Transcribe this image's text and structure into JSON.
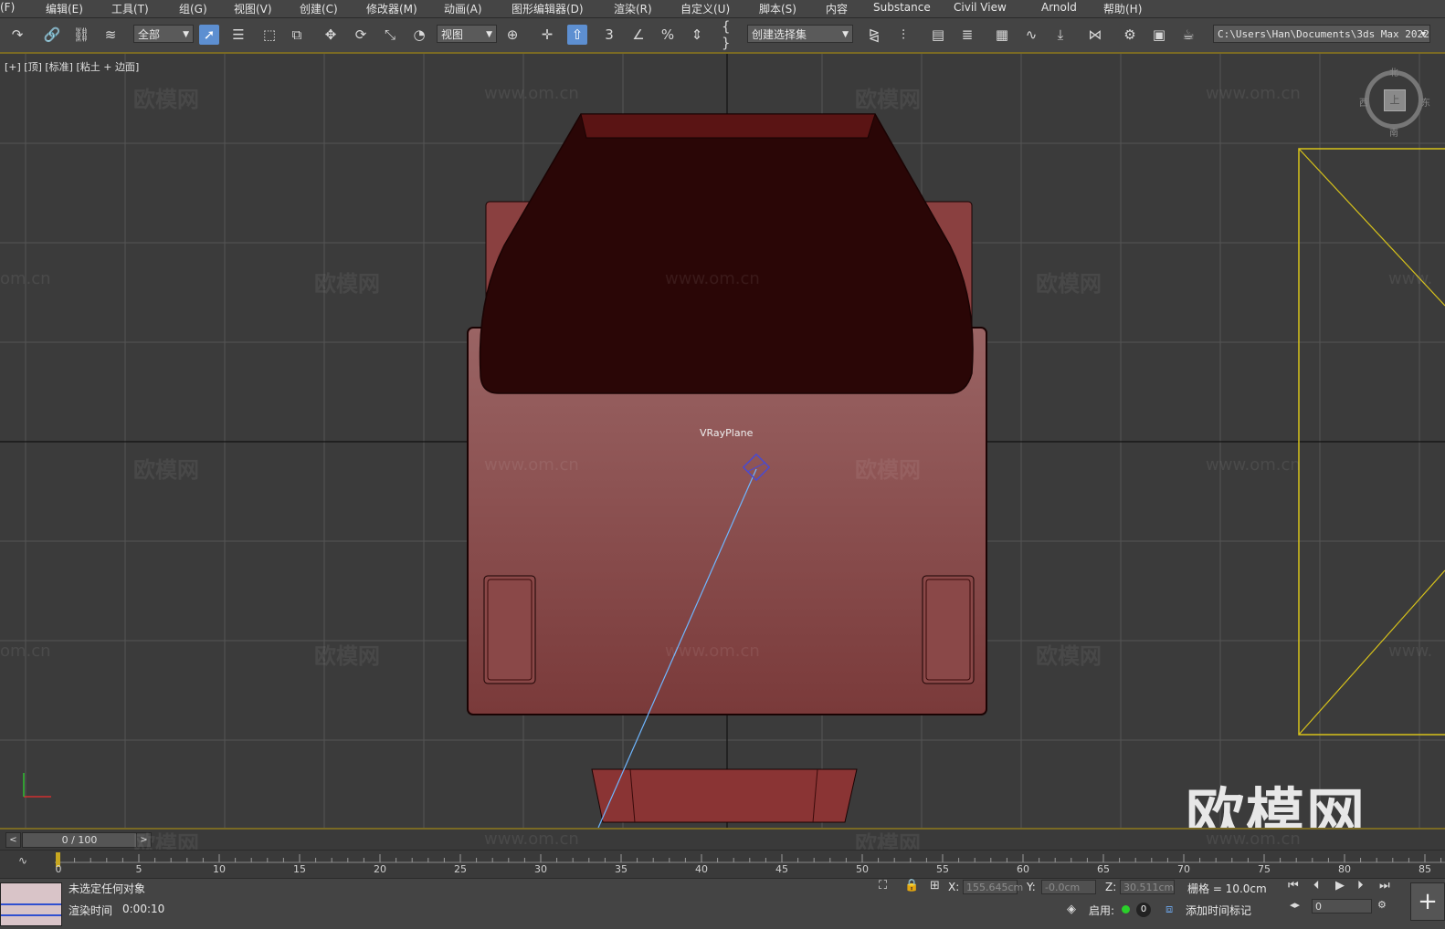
{
  "menu": [
    "(F)",
    "编辑(E)",
    "工具(T)",
    "组(G)",
    "视图(V)",
    "创建(C)",
    "修改器(M)",
    "动画(A)",
    "图形编辑器(D)",
    "渲染(R)",
    "自定义(U)",
    "脚本(S)",
    "内容",
    "Substance",
    "Civil View",
    "Arnold",
    "帮助(H)"
  ],
  "toolbar": {
    "selection_filter": "全部",
    "ref_coord": "视图",
    "named_selection": "创建选择集",
    "project_path": "C:\\Users\\Han\\Documents\\3ds Max 2022",
    "snap_3": "3"
  },
  "viewport": {
    "label": "[+] [顶] [标准] [粘土 + 边面]",
    "object_label": "VRayPlane",
    "watermark_text": "欧模网",
    "watermark_url": "www.om.cn",
    "watermark_url_partial": "om.cn",
    "watermark_url_partial_right": "www.",
    "big_watermark": "欧模网",
    "viewcube": {
      "north": "北",
      "south": "南",
      "west": "西",
      "east": "东",
      "face": "上"
    },
    "colors": {
      "object_fill": "#8a4a4a",
      "object_dark": "#2a0606",
      "selection_yellow": "#d8c31a",
      "light_line": "#6fb6ff"
    }
  },
  "timeline": {
    "frame_display": "0 / 100",
    "prev": "<",
    "next": ">",
    "ticks": [
      "0",
      "5",
      "10",
      "15",
      "20",
      "25",
      "30",
      "35",
      "40",
      "45",
      "50",
      "55",
      "60",
      "65",
      "70",
      "75",
      "80",
      "85"
    ]
  },
  "status": {
    "selection": "未选定任何对象",
    "render_time_label": "渲染时间",
    "render_time_value": "0:00:10",
    "x_label": "X:",
    "x_value": "155.645cm",
    "y_label": "Y:",
    "y_value": "-0.0cm",
    "z_label": "Z:",
    "z_value": "30.511cm",
    "grid": "栅格 = 10.0cm",
    "enable_label": "启用:",
    "enable_count": "0",
    "add_time_tag": "添加时间标记",
    "current_frame": "0"
  }
}
